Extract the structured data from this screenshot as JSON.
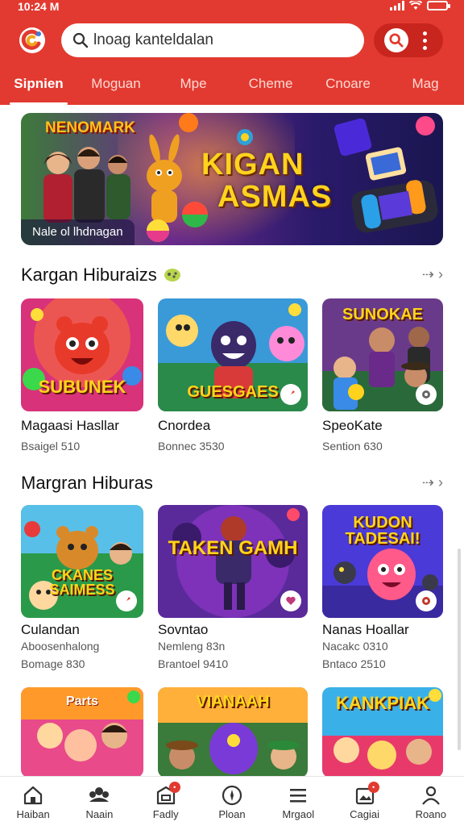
{
  "status_bar": {
    "time": "10:24 M"
  },
  "search": {
    "value": "lnoag kanteldalan"
  },
  "tabs": [
    "Sipnien",
    "Moguan",
    "Mpe",
    "Cheme",
    "Cnoare",
    "Mag"
  ],
  "banner": {
    "tag": "NENOMARK",
    "title_line1": "KIGAN",
    "title_line2": "ASMAS",
    "subtitle": "Nale ol lhdnagan"
  },
  "section1": {
    "title": "Kargan Hiburaizs",
    "cards": [
      {
        "art_text": "SUBUNEK",
        "name": "Magaasi Hasllar",
        "meta": "Bsaigel 510"
      },
      {
        "art_text": "GUESGAES",
        "name": "Cnordea",
        "meta": "Bonnec 3530"
      },
      {
        "art_text": "SUNOKAE",
        "name": "SpeoKate",
        "meta": "Sention 630"
      }
    ]
  },
  "section2": {
    "title": "Margran Hiburas",
    "cards": [
      {
        "art_text": "CKANES SAIMESS",
        "name": "Culandan",
        "meta": "Aboosenhalong",
        "meta2": "Bomage 830"
      },
      {
        "art_text": "TAKEN GAMH",
        "name": "Sovntao",
        "meta": "Nemleng 83n",
        "meta2": "Brantoel 9410"
      },
      {
        "art_text": "KUDON TADESAI!",
        "name": "Nanas Hoallar",
        "meta": "Nacakc 0310",
        "meta2": "Bntaco 2510"
      }
    ]
  },
  "section3": {
    "art_texts": [
      "Parts",
      "VIANAAH",
      "KANKPIAK"
    ]
  },
  "bottom_nav": [
    {
      "label": "Haiban",
      "icon": "home-icon"
    },
    {
      "label": "Naain",
      "icon": "people-icon"
    },
    {
      "label": "Fadly",
      "icon": "store-icon"
    },
    {
      "label": "Ploan",
      "icon": "compass-icon"
    },
    {
      "label": "Mrgaol",
      "icon": "menu-icon"
    },
    {
      "label": "Cagiai",
      "icon": "gallery-icon"
    },
    {
      "label": "Roano",
      "icon": "profile-icon"
    }
  ],
  "colors": {
    "header_red": "#e23a30",
    "accent_dark_red": "#c8251e",
    "title_yellow": "#ffd51a"
  }
}
